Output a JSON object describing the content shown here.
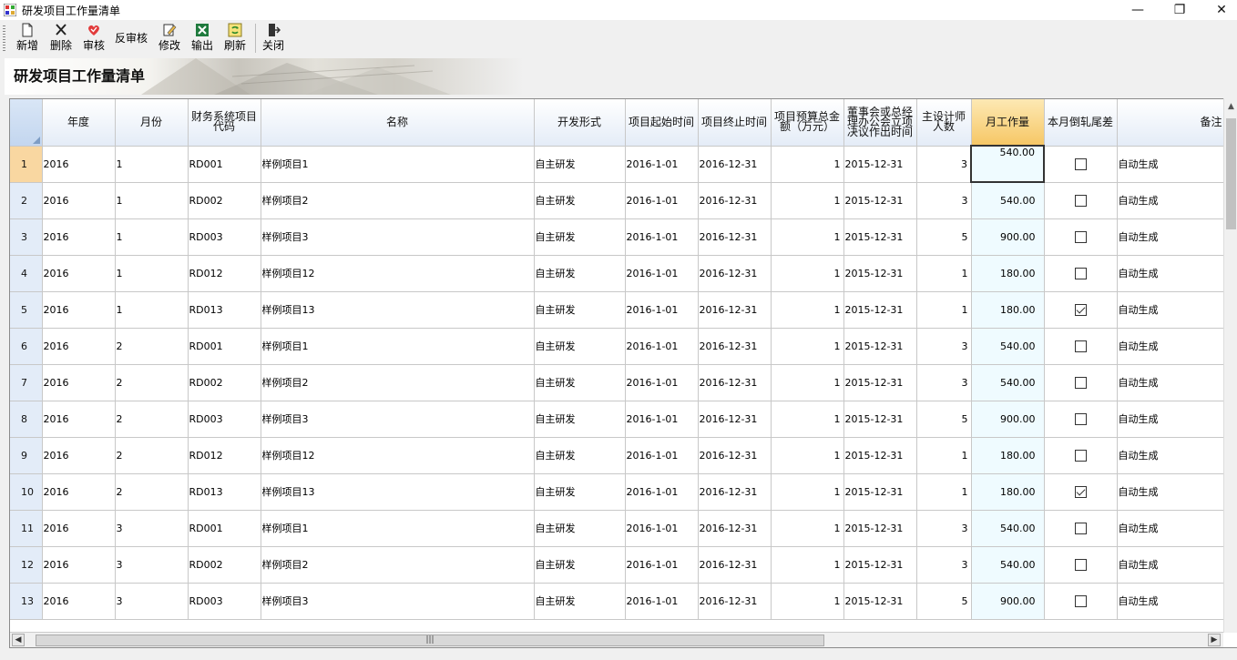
{
  "window": {
    "title": "研发项目工作量清单"
  },
  "toolbar": {
    "new_label": "新增",
    "delete_label": "删除",
    "approve_label": "审核",
    "unapprove_label": "反审核",
    "edit_label": "修改",
    "export_label": "输出",
    "refresh_label": "刷新",
    "close_label": "关闭"
  },
  "banner": {
    "title": "研发项目工作量清单"
  },
  "grid": {
    "columns": [
      "年度",
      "月份",
      "财务系统项目代码",
      "名称",
      "开发形式",
      "项目起始时间",
      "项目终止时间",
      "项目预算总金额（万元）",
      "董事会或总经理办公会立项决议作出时间",
      "主设计师人数",
      "月工作量",
      "本月倒轧尾差",
      "备注"
    ],
    "rows": [
      {
        "row": "1",
        "year": "2016",
        "month": "1",
        "code": "RD001",
        "name": "样例项目1",
        "dev": "自主研发",
        "start": "2016-1-01",
        "end": "2016-12-31",
        "budget": "1",
        "decision": "2015-12-31",
        "designers": "3",
        "workload": "540.00",
        "adjust": false,
        "note": "自动生成"
      },
      {
        "row": "2",
        "year": "2016",
        "month": "1",
        "code": "RD002",
        "name": "样例项目2",
        "dev": "自主研发",
        "start": "2016-1-01",
        "end": "2016-12-31",
        "budget": "1",
        "decision": "2015-12-31",
        "designers": "3",
        "workload": "540.00",
        "adjust": false,
        "note": "自动生成"
      },
      {
        "row": "3",
        "year": "2016",
        "month": "1",
        "code": "RD003",
        "name": "样例项目3",
        "dev": "自主研发",
        "start": "2016-1-01",
        "end": "2016-12-31",
        "budget": "1",
        "decision": "2015-12-31",
        "designers": "5",
        "workload": "900.00",
        "adjust": false,
        "note": "自动生成"
      },
      {
        "row": "4",
        "year": "2016",
        "month": "1",
        "code": "RD012",
        "name": "样例项目12",
        "dev": "自主研发",
        "start": "2016-1-01",
        "end": "2016-12-31",
        "budget": "1",
        "decision": "2015-12-31",
        "designers": "1",
        "workload": "180.00",
        "adjust": false,
        "note": "自动生成"
      },
      {
        "row": "5",
        "year": "2016",
        "month": "1",
        "code": "RD013",
        "name": "样例项目13",
        "dev": "自主研发",
        "start": "2016-1-01",
        "end": "2016-12-31",
        "budget": "1",
        "decision": "2015-12-31",
        "designers": "1",
        "workload": "180.00",
        "adjust": true,
        "note": "自动生成"
      },
      {
        "row": "6",
        "year": "2016",
        "month": "2",
        "code": "RD001",
        "name": "样例项目1",
        "dev": "自主研发",
        "start": "2016-1-01",
        "end": "2016-12-31",
        "budget": "1",
        "decision": "2015-12-31",
        "designers": "3",
        "workload": "540.00",
        "adjust": false,
        "note": "自动生成"
      },
      {
        "row": "7",
        "year": "2016",
        "month": "2",
        "code": "RD002",
        "name": "样例项目2",
        "dev": "自主研发",
        "start": "2016-1-01",
        "end": "2016-12-31",
        "budget": "1",
        "decision": "2015-12-31",
        "designers": "3",
        "workload": "540.00",
        "adjust": false,
        "note": "自动生成"
      },
      {
        "row": "8",
        "year": "2016",
        "month": "2",
        "code": "RD003",
        "name": "样例项目3",
        "dev": "自主研发",
        "start": "2016-1-01",
        "end": "2016-12-31",
        "budget": "1",
        "decision": "2015-12-31",
        "designers": "5",
        "workload": "900.00",
        "adjust": false,
        "note": "自动生成"
      },
      {
        "row": "9",
        "year": "2016",
        "month": "2",
        "code": "RD012",
        "name": "样例项目12",
        "dev": "自主研发",
        "start": "2016-1-01",
        "end": "2016-12-31",
        "budget": "1",
        "decision": "2015-12-31",
        "designers": "1",
        "workload": "180.00",
        "adjust": false,
        "note": "自动生成"
      },
      {
        "row": "10",
        "year": "2016",
        "month": "2",
        "code": "RD013",
        "name": "样例项目13",
        "dev": "自主研发",
        "start": "2016-1-01",
        "end": "2016-12-31",
        "budget": "1",
        "decision": "2015-12-31",
        "designers": "1",
        "workload": "180.00",
        "adjust": true,
        "note": "自动生成"
      },
      {
        "row": "11",
        "year": "2016",
        "month": "3",
        "code": "RD001",
        "name": "样例项目1",
        "dev": "自主研发",
        "start": "2016-1-01",
        "end": "2016-12-31",
        "budget": "1",
        "decision": "2015-12-31",
        "designers": "3",
        "workload": "540.00",
        "adjust": false,
        "note": "自动生成"
      },
      {
        "row": "12",
        "year": "2016",
        "month": "3",
        "code": "RD002",
        "name": "样例项目2",
        "dev": "自主研发",
        "start": "2016-1-01",
        "end": "2016-12-31",
        "budget": "1",
        "decision": "2015-12-31",
        "designers": "3",
        "workload": "540.00",
        "adjust": false,
        "note": "自动生成"
      },
      {
        "row": "13",
        "year": "2016",
        "month": "3",
        "code": "RD003",
        "name": "样例项目3",
        "dev": "自主研发",
        "start": "2016-1-01",
        "end": "2016-12-31",
        "budget": "1",
        "decision": "2015-12-31",
        "designers": "5",
        "workload": "900.00",
        "adjust": false,
        "note": "自动生成"
      }
    ]
  }
}
